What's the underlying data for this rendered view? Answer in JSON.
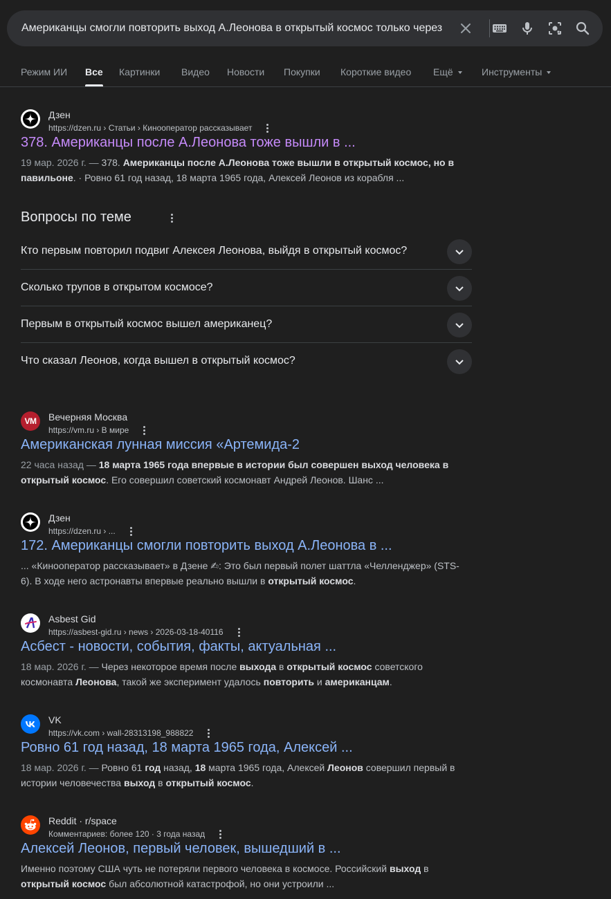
{
  "search": {
    "query": "Американцы смогли повторить выход А.Леонова в открытый космос только через"
  },
  "tabs": [
    {
      "label": "Режим ИИ"
    },
    {
      "label": "Все"
    },
    {
      "label": "Картинки"
    },
    {
      "label": "Видео"
    },
    {
      "label": "Новости"
    },
    {
      "label": "Покупки"
    },
    {
      "label": "Короткие видео"
    },
    {
      "label": "Ещё"
    },
    {
      "label": "Инструменты"
    }
  ],
  "results": [
    {
      "site": "Дзен",
      "url": "https://dzen.ru › Статьи › Кинооператор рассказывает",
      "title": "378. Американцы после А.Леонова тоже вышли в ...",
      "date": "19 мар. 2026 г. — ",
      "s1": "378. ",
      "s2": "Американцы после А.Леонова тоже вышли в открытый космос, но в павильоне",
      "s3": ". · Ровно 61 год назад, 18 марта 1965 года, Алексей Леонов из корабля ..."
    },
    {
      "site": "Вечерняя Москва",
      "favicon_text": "VM",
      "url": "https://vm.ru › В мире",
      "title": "Американская лунная миссия «Артемида-2",
      "date": "22 часа назад — ",
      "s1": "18 марта 1965 года впервые в истории был совершен выход человека в открытый космос",
      "s2": ". Его совершил советский космонавт Андрей Леонов. Шанс ..."
    },
    {
      "site": "Дзен",
      "url": "https://dzen.ru › ...",
      "title": "172. Американцы смогли повторить выход А.Леонова в ...",
      "s1": "... «Кинооператор рассказывает» в Дзене ✍: Это был первый полет шаттла «Челленджер» (STS-6). В ходе него астронавты впервые реально вышли в ",
      "s2": "открытый космос",
      "s3": "."
    },
    {
      "site": "Asbest Gid",
      "url": "https://asbest-gid.ru › news › 2026-03-18-40116",
      "title": "Асбест - новости, события, факты, актуальная ...",
      "date": "18 мар. 2026 г. — ",
      "s1": "Через некоторое время после ",
      "b1": "выхода",
      "s2": " в ",
      "b2": "открытый космос",
      "s3": " советского космонавта ",
      "b3": "Леонова",
      "s4": ", такой же эксперимент удалось ",
      "b4": "повторить",
      "s5": " и ",
      "b5": "американцам",
      "s6": "."
    },
    {
      "site": "VK",
      "url": "https://vk.com › wall-28313198_988822",
      "title": "Ровно 61 год назад, 18 марта 1965 года, Алексей ...",
      "date": "18 мар. 2026 г. — ",
      "s1": "Ровно 61 ",
      "b1": "год",
      "s2": " назад, ",
      "b2": "18",
      "s3": " марта 1965 года, Алексей ",
      "b3": "Леонов",
      "s4": " совершил первый в истории человечества ",
      "b4": "выход",
      "s5": " в ",
      "b5": "открытый космос",
      "s6": "."
    },
    {
      "site": "Reddit · r/space",
      "url": "Комментариев: более 120 · 3 года назад",
      "title": "Алексей Леонов, первый человек, вышедший в ...",
      "s1": "Именно поэтому США чуть не потеряли первого человека в космосе. Российский ",
      "b1": "выход",
      "s2": " в ",
      "b2": "открытый космос",
      "s3": " был абсолютной катастрофой, но они устроили ..."
    }
  ],
  "paa": {
    "title": "Вопросы по теме",
    "questions": [
      "Кто первым повторил подвиг Алексея Леонова, выйдя в открытый космос?",
      "Сколько трупов в открытом космосе?",
      "Первым в открытый космос вышел американец?",
      "Что сказал Леонов, когда вышел в открытый космос?"
    ]
  },
  "colors": {
    "background": "#1f1f1f",
    "link": "#8ab4f8",
    "visited": "#c58af9"
  }
}
